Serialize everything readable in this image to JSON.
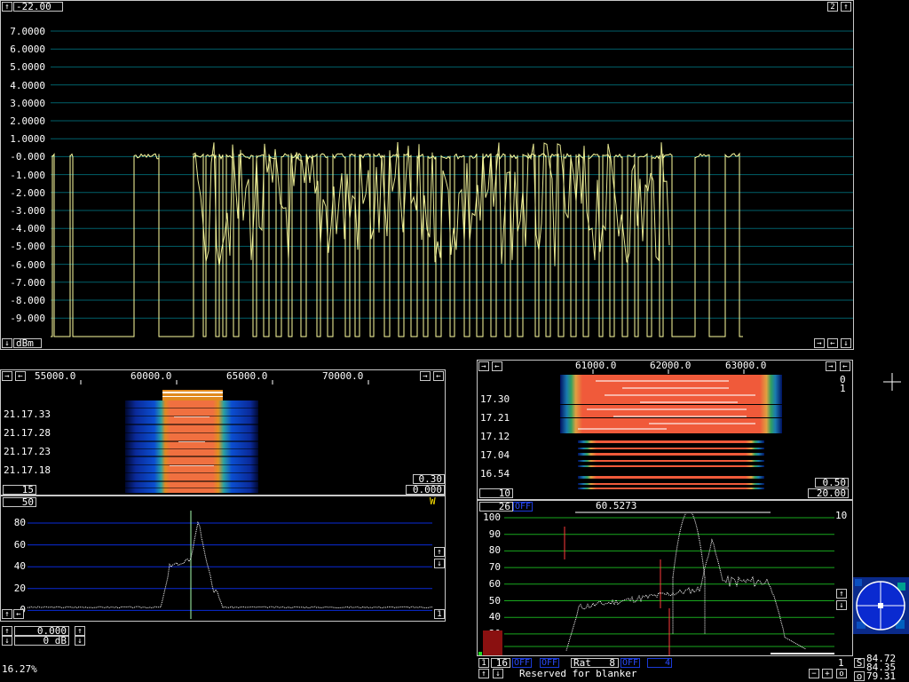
{
  "top_graph": {
    "ref_level": "-22.00",
    "unit": "dBm",
    "trace_number": "2",
    "y_labels": [
      "7.0000",
      "6.0000",
      "5.0000",
      "4.0000",
      "3.0000",
      "2.0000",
      "1.0000",
      "-0.000",
      "-1.000",
      "-2.000",
      "-3.000",
      "-4.000",
      "-5.000",
      "-6.000",
      "-7.000",
      "-8.000",
      "-9.000"
    ],
    "colors": {
      "trace": "#ffffa0",
      "grid": "#00606a"
    }
  },
  "left_waterfall": {
    "freq_labels": [
      "55000.0",
      "60000.0",
      "65000.0",
      "70000.0"
    ],
    "time_labels": [
      "21.17.33",
      "21.17.28",
      "21.17.23",
      "21.17.18"
    ],
    "avg_value": "15",
    "gain_value": "0.30",
    "offset_value": "0.000"
  },
  "left_spectrum": {
    "avg_value": "50",
    "w_label": "W",
    "y_labels": [
      "80",
      "60",
      "40",
      "20",
      "0"
    ],
    "level_value": "0.000",
    "db_value": "0 dB",
    "percent": "16.27%",
    "bottom_right_number": "1",
    "colors": {
      "grid": "#0a2bd8",
      "trace": "#ffffff",
      "marker": "#a8ffb0"
    }
  },
  "right_waterfall": {
    "freq_labels": [
      "61000.0",
      "62000.0",
      "63000.0"
    ],
    "time_labels": [
      "17.30",
      "17.21",
      "17.12",
      "17.04",
      "16.54"
    ],
    "side_numbers": [
      "0",
      "1"
    ],
    "avg_value": "10",
    "gain_value": "0.50",
    "offset_value": "20.00"
  },
  "right_spectrum": {
    "avg_value": "26",
    "off_label": "OFF",
    "center_freq": "60.5273",
    "scale_right": "10",
    "y_labels": [
      "100",
      "90",
      "80",
      "70",
      "60",
      "50",
      "40",
      "30"
    ],
    "bottom_left_1": "1",
    "bottom_left_2": "16",
    "off_labels": [
      "OFF",
      "OFF"
    ],
    "rat_label": "Rat",
    "rat_value": "8",
    "off_label_3": "OFF",
    "value_4": "4",
    "bottom_right_number": "1",
    "status_text": "Reserved for blanker",
    "colors": {
      "grid": "#19a81e",
      "trace": "#ffffff",
      "marker": "#ff3a3a",
      "bar": "#8a1010"
    }
  },
  "meter": {
    "s_label": "S",
    "s_value": "84.72",
    "mid_value": "84.35",
    "o_label": "o",
    "o_value": "79.31"
  }
}
